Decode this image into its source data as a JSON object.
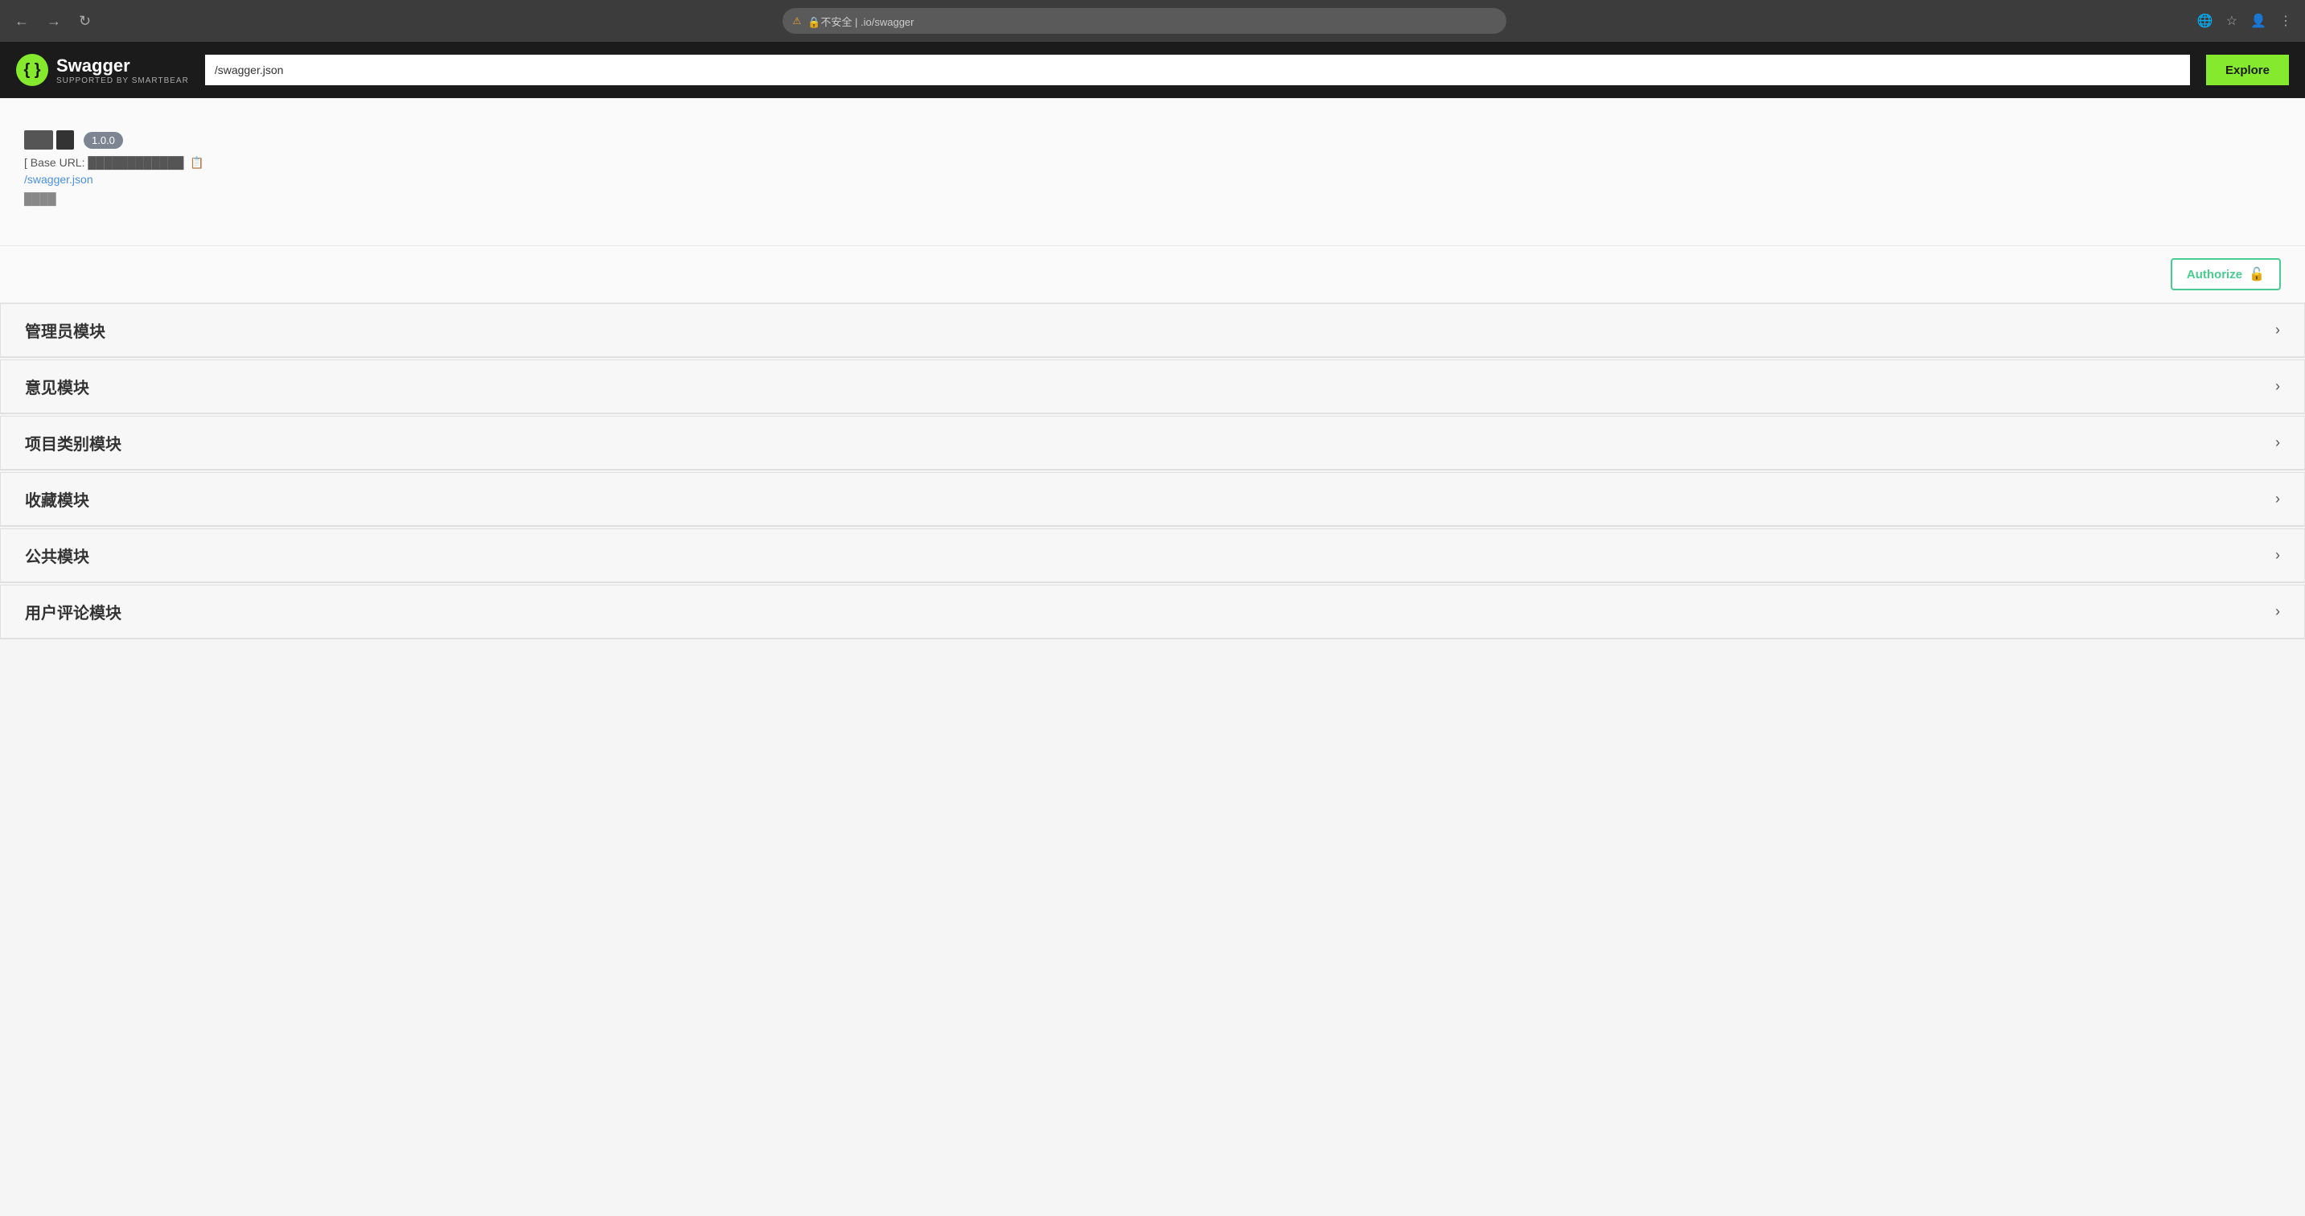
{
  "browser": {
    "back_label": "←",
    "forward_label": "→",
    "reload_label": "↻",
    "warning_label": "⚠",
    "address_text": "🔒不安全  |      .io/swagger",
    "address_short": ".io/swagger"
  },
  "topbar": {
    "logo_icon": "{ }",
    "logo_title": "Swagger",
    "logo_subtitle": "SUPPORTED BY SMARTBEAR",
    "url_input_value": "/swagger.json",
    "explore_label": "Explore"
  },
  "info": {
    "version_badge": "1.0.0",
    "base_url_label": "[ Base URL:",
    "base_url_value": "…",
    "swagger_link": "/swagger.json",
    "description": "…"
  },
  "authorize": {
    "button_label": "Authorize",
    "lock_icon": "🔓"
  },
  "sections": [
    {
      "title": "管理员模块",
      "chevron": "›"
    },
    {
      "title": "意见模块",
      "chevron": "›"
    },
    {
      "title": "项目类别模块",
      "chevron": "›"
    },
    {
      "title": "收藏模块",
      "chevron": "›"
    },
    {
      "title": "公共模块",
      "chevron": "›"
    },
    {
      "title": "用户评论模块",
      "chevron": "›"
    }
  ]
}
